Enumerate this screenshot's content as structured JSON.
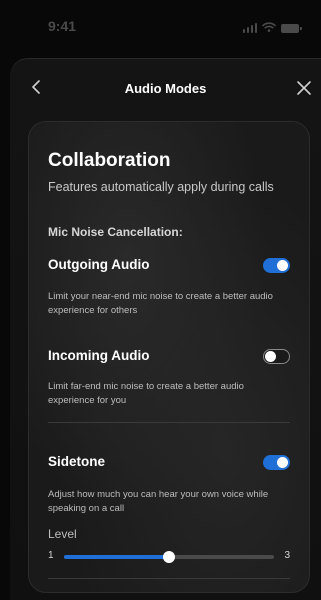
{
  "status_bar": {
    "time": "9:41",
    "icons": [
      "signal-icon",
      "wifi-icon",
      "battery-icon"
    ]
  },
  "header": {
    "title": "Audio Modes",
    "back_icon": "chevron-left-icon",
    "close_icon": "close-icon"
  },
  "card": {
    "title": "Collaboration",
    "subtitle": "Features automatically apply during calls",
    "section_label": "Mic Noise Cancellation:",
    "settings": [
      {
        "title": "Outgoing Audio",
        "description": "Limit your near-end mic noise to create a better audio experience for others",
        "enabled": true
      },
      {
        "title": "Incoming Audio",
        "description": "Limit far-end mic noise to create a better audio experience for you",
        "enabled": false
      },
      {
        "title": "Sidetone",
        "description": "Adjust how much you can hear your own voice while speaking on a call",
        "enabled": true
      }
    ],
    "level": {
      "label": "Level",
      "min": "1",
      "max": "3",
      "value_fraction": 0.5
    }
  },
  "colors": {
    "accent": "#1f6fd6",
    "background": "#080808",
    "card": "#1a1a1a",
    "text_primary": "#ffffff",
    "text_secondary": "#bdbdbd"
  }
}
